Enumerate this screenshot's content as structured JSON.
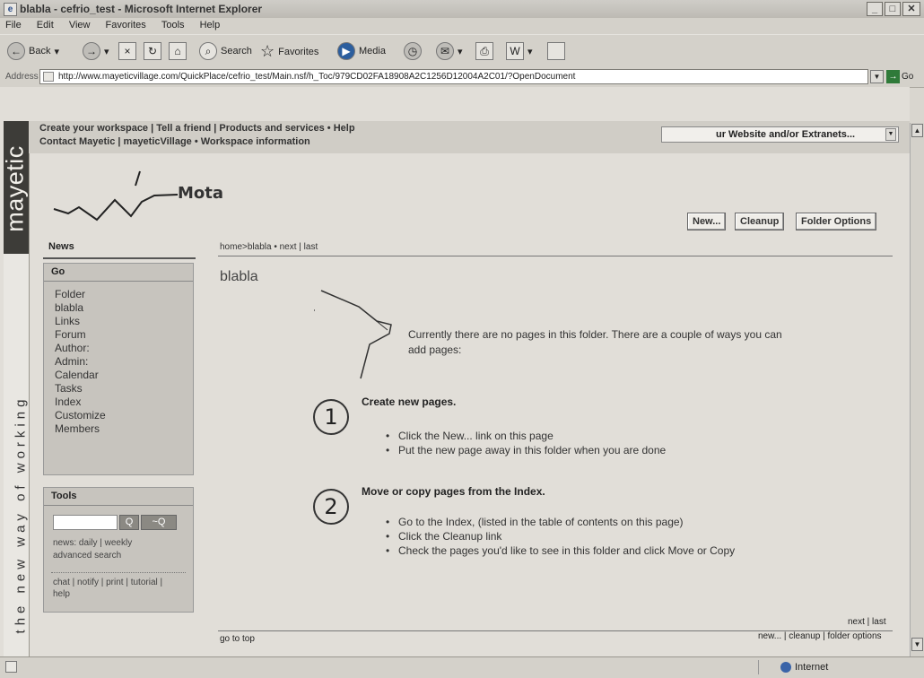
{
  "window": {
    "title": "blabla - cefrio_test - Microsoft Internet Explorer",
    "min": "_",
    "max": "□",
    "close": "✕"
  },
  "menu": [
    "File",
    "Edit",
    "View",
    "Favorites",
    "Tools",
    "Help"
  ],
  "toolbar": {
    "back": "Back",
    "search": "Search",
    "favorites": "Favorites",
    "media": "Media"
  },
  "address": {
    "label": "Address",
    "url": "http://www.mayeticvillage.com/QuickPlace/cefrio_test/Main.nsf/h_Toc/979CD02FA18908A2C1256D12004A2C01/?OpenDocument",
    "go": "Go"
  },
  "brand": {
    "logo": "mayetic",
    "tagline": "the new way of working"
  },
  "toplinks": {
    "line1": "Create your workspace | Tell a friend | Products and services  •  Help",
    "line2": "Contact Mayetic | mayeticVillage  •  Workspace information",
    "dropdown": "ur Website and/or Extranets..."
  },
  "logo": {
    "text": "Mota"
  },
  "buttons": {
    "new": "New...",
    "cleanup": "Cleanup",
    "folder_options": "Folder Options"
  },
  "nav": {
    "news": "News",
    "go": "Go",
    "items": [
      "Folder",
      "blabla",
      "Links",
      "Forum",
      "Author:",
      "Admin:",
      "Calendar",
      "Tasks",
      "Index",
      "Customize",
      "Members"
    ],
    "tools": "Tools",
    "search_btn": "Q",
    "adv_btn": "~Q",
    "links1": "news: daily | weekly",
    "links2": "advanced search",
    "links3": "chat | notify | print | tutorial |",
    "links4": "help"
  },
  "main": {
    "breadcrumb": "home>blabla  •  next | last",
    "title": "blabla",
    "empty_msg": "Currently there are no pages in this folder. There are a couple of ways you can add pages:",
    "step1": {
      "num": "1",
      "heading": "Create new pages.",
      "b1": "Click the New... link on this page",
      "b2": "Put the new page away in this folder when you are done"
    },
    "step2": {
      "num": "2",
      "heading": "Move or copy pages from the Index.",
      "b1": "Go to the Index, (listed in the table of contents on this page)",
      "b2": "Click the Cleanup link",
      "b3": "Check the pages you'd like to see in this folder and click Move or Copy"
    },
    "next_last": "next | last",
    "go_to_top": "go to top",
    "footer_opts": "new... | cleanup | folder options"
  },
  "status": {
    "zone": "Internet"
  }
}
